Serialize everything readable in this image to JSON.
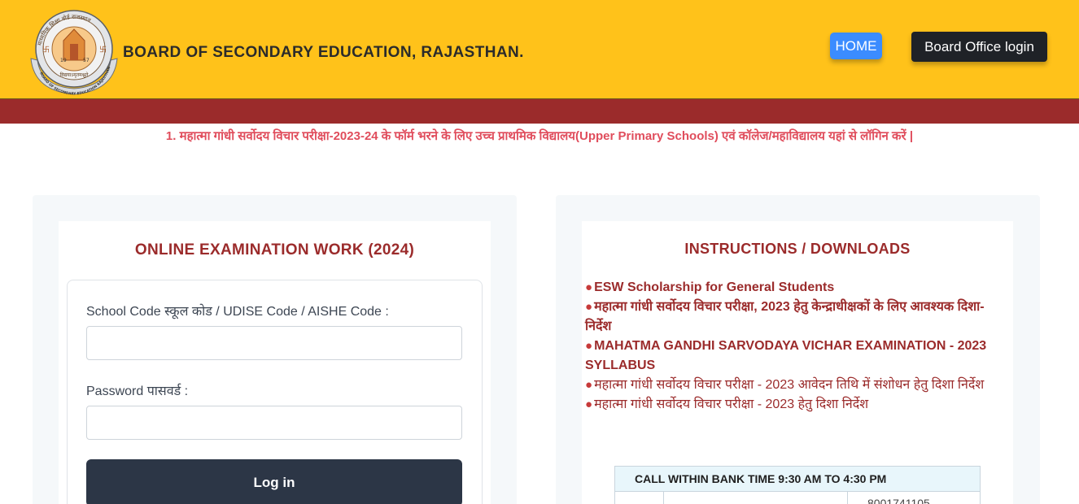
{
  "header": {
    "title": "BOARD OF SECONDARY EDUCATION, RAJASTHAN.",
    "home_label": "HOME",
    "board_login_label": "Board Office login",
    "logo": {
      "ring_text": "माध्यमिक शिक्षा बोर्ड राजस्थान",
      "bottom_text": "BOARD OF SECONDARY EDUCATION RAJASTHAN",
      "year_left": "19",
      "year_right": "57",
      "motto": "विद्ययाऽमृतमश्नुते"
    }
  },
  "notice": {
    "text": "1. महात्मा गांधी सर्वोदय विचार परीक्षा-2023-24 के फॉर्म भरने के लिए उच्च प्राथमिक विद्यालय(Upper Primary Schools) एवं कॉलेज/महाविद्यालय यहां से लॉगिन करें |"
  },
  "login": {
    "title": "ONLINE EXAMINATION WORK (2024)",
    "school_code_label": "School Code स्कूल कोड / UDISE Code / AISHE Code :",
    "school_code_value": "",
    "password_label": "Password पासवर्ड :",
    "password_value": "",
    "login_button": "Log in"
  },
  "instructions": {
    "title": "INSTRUCTIONS / DOWNLOADS",
    "bullet": "●",
    "items": [
      {
        "text": "ESW Scholarship for General Students",
        "bold": true
      },
      {
        "text": "महात्मा गांधी सर्वोदय विचार परीक्षा, 2023 हेतु केन्द्राधीक्षकों के लिए आवश्यक दिशा-निर्देश",
        "bold": true
      },
      {
        "text": "MAHATMA GANDHI SARVODAYA VICHAR EXAMINATION - 2023 SYLLABUS",
        "bold": true
      },
      {
        "text": "महात्मा गांधी सर्वोदय विचार परीक्षा - 2023 आवेदन तिथि में संशोधन हेतु दिशा निर्देश",
        "bold": false
      },
      {
        "text": "महात्मा गांधी सर्वोदय विचार परीक्षा - 2023 हेतु दिशा निर्देश",
        "bold": false
      }
    ]
  },
  "bank_table": {
    "header": "CALL WITHIN BANK TIME 9:30 AM TO 4:30 PM",
    "phone": "8001741105"
  },
  "colors": {
    "header_bg": "#ffc21a",
    "band": "#9b2b2b",
    "accent_red": "#9b2b2b",
    "notice_red": "#e04d5c",
    "home_blue": "#3b8cff",
    "dark_button": "#2c3646"
  }
}
